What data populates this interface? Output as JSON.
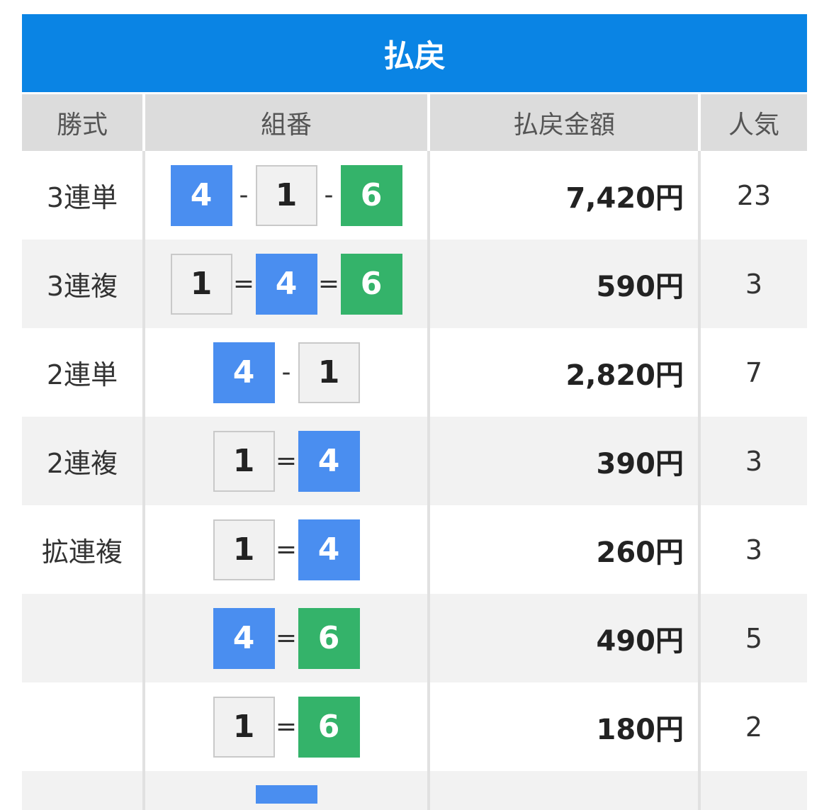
{
  "title": "払戻",
  "headers": {
    "type": "勝式",
    "combo": "組番",
    "amount": "払戻金額",
    "popularity": "人気"
  },
  "rows": [
    {
      "type": "3連単",
      "combo": [
        {
          "n": "4",
          "color": "blue"
        },
        {
          "sep": "-"
        },
        {
          "n": "1",
          "color": "white"
        },
        {
          "sep": "-"
        },
        {
          "n": "6",
          "color": "green"
        }
      ],
      "amount": "7,420円",
      "popularity": "23"
    },
    {
      "type": "3連複",
      "combo": [
        {
          "n": "1",
          "color": "white"
        },
        {
          "sep": "="
        },
        {
          "n": "4",
          "color": "blue"
        },
        {
          "sep": "="
        },
        {
          "n": "6",
          "color": "green"
        }
      ],
      "amount": "590円",
      "popularity": "3"
    },
    {
      "type": "2連単",
      "combo": [
        {
          "n": "4",
          "color": "blue"
        },
        {
          "sep": "-"
        },
        {
          "n": "1",
          "color": "white"
        }
      ],
      "amount": "2,820円",
      "popularity": "7"
    },
    {
      "type": "2連複",
      "combo": [
        {
          "n": "1",
          "color": "white"
        },
        {
          "sep": "="
        },
        {
          "n": "4",
          "color": "blue"
        }
      ],
      "amount": "390円",
      "popularity": "3"
    },
    {
      "type": "拡連複",
      "combo": [
        {
          "n": "1",
          "color": "white"
        },
        {
          "sep": "="
        },
        {
          "n": "4",
          "color": "blue"
        }
      ],
      "amount": "260円",
      "popularity": "3"
    },
    {
      "type": "",
      "combo": [
        {
          "n": "4",
          "color": "blue"
        },
        {
          "sep": "="
        },
        {
          "n": "6",
          "color": "green"
        }
      ],
      "amount": "490円",
      "popularity": "5"
    },
    {
      "type": "",
      "combo": [
        {
          "n": "1",
          "color": "white"
        },
        {
          "sep": "="
        },
        {
          "n": "6",
          "color": "green"
        }
      ],
      "amount": "180円",
      "popularity": "2"
    }
  ],
  "colors": {
    "title_bg": "#0a84e4",
    "blue": "#4a8ef0",
    "green": "#34b36a",
    "white": "#f1f1f1"
  }
}
